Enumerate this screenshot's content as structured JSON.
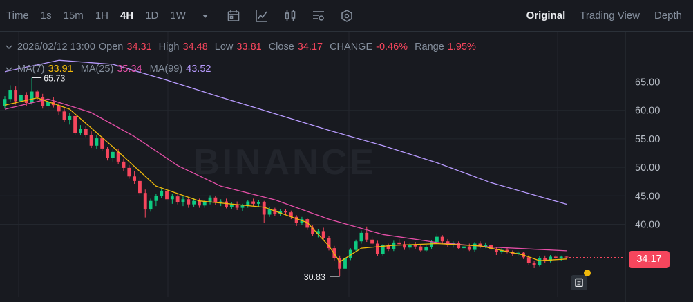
{
  "toolbar": {
    "timeframes": [
      "Time",
      "1s",
      "15m",
      "1H",
      "4H",
      "1D",
      "1W"
    ],
    "active_timeframe": "4H",
    "views": [
      "Original",
      "Trading View",
      "Depth"
    ],
    "active_view": "Original"
  },
  "ohlc": {
    "datetime": "2026/02/12 13:00",
    "open_label": "Open",
    "open": "34.31",
    "high_label": "High",
    "high": "34.48",
    "low_label": "Low",
    "low": "33.81",
    "close_label": "Close",
    "close": "34.17",
    "change_label": "CHANGE",
    "change": "-0.46%",
    "range_label": "Range",
    "range": "1.95%"
  },
  "ma": {
    "ma7_label": "MA(7)",
    "ma7": "33.91",
    "ma25_label": "MA(25)",
    "ma25": "35.34",
    "ma99_label": "MA(99)",
    "ma99": "43.52"
  },
  "watermark": "BINANCE",
  "current_price": "34.17",
  "colors": {
    "up": "#0ecb81",
    "down": "#f6465d",
    "ma7": "#f0b90b",
    "ma25": "#e64fa8",
    "ma99": "#b89bff",
    "background": "#181a20",
    "grid": "#23272e"
  },
  "chart_data": {
    "type": "candlestick",
    "y_ticks": [
      "65.00",
      "60.00",
      "55.00",
      "50.00",
      "45.00",
      "40.00"
    ],
    "ylim": [
      28.0,
      70.0
    ],
    "grid": true,
    "high_marker": "65.73",
    "low_marker": "30.83",
    "candles": [
      [
        60.8,
        62.5,
        60.3,
        62.0
      ],
      [
        62.0,
        64.4,
        61.5,
        63.6
      ],
      [
        63.6,
        64.2,
        61.0,
        61.6
      ],
      [
        61.6,
        63.0,
        60.9,
        62.7
      ],
      [
        62.7,
        63.2,
        60.7,
        61.3
      ],
      [
        61.3,
        65.73,
        61.0,
        63.3
      ],
      [
        63.3,
        63.6,
        61.9,
        62.3
      ],
      [
        62.3,
        62.9,
        60.3,
        60.8
      ],
      [
        60.8,
        62.0,
        60.0,
        61.5
      ],
      [
        61.5,
        62.3,
        60.5,
        60.9
      ],
      [
        60.9,
        61.4,
        59.2,
        59.8
      ],
      [
        59.8,
        60.3,
        57.9,
        58.3
      ],
      [
        58.3,
        59.6,
        57.5,
        59.0
      ],
      [
        59.0,
        59.3,
        55.6,
        56.0
      ],
      [
        56.0,
        57.4,
        55.6,
        56.8
      ],
      [
        56.8,
        57.3,
        55.3,
        55.7
      ],
      [
        55.7,
        56.3,
        53.4,
        53.8
      ],
      [
        53.8,
        55.6,
        53.2,
        55.1
      ],
      [
        55.1,
        55.4,
        52.9,
        53.3
      ],
      [
        53.3,
        53.6,
        51.2,
        51.7
      ],
      [
        51.7,
        53.2,
        51.0,
        52.7
      ],
      [
        52.7,
        53.3,
        50.6,
        51.0
      ],
      [
        51.0,
        51.5,
        49.3,
        49.9
      ],
      [
        49.9,
        50.4,
        48.0,
        48.4
      ],
      [
        48.4,
        49.3,
        47.1,
        47.6
      ],
      [
        47.6,
        48.3,
        45.1,
        45.5
      ],
      [
        45.5,
        46.1,
        41.2,
        42.6
      ],
      [
        42.6,
        44.5,
        42.2,
        44.1
      ],
      [
        44.1,
        45.4,
        43.2,
        45.0
      ],
      [
        45.0,
        46.3,
        44.6,
        45.9
      ],
      [
        45.9,
        46.3,
        44.0,
        44.4
      ],
      [
        44.4,
        45.3,
        43.6,
        44.9
      ],
      [
        44.9,
        45.3,
        43.5,
        43.9
      ],
      [
        43.9,
        44.9,
        43.2,
        44.4
      ],
      [
        44.4,
        44.8,
        42.9,
        43.5
      ],
      [
        43.5,
        44.6,
        43.1,
        44.1
      ],
      [
        44.1,
        44.5,
        42.9,
        43.3
      ],
      [
        43.3,
        44.2,
        42.9,
        43.9
      ],
      [
        43.9,
        45.1,
        43.5,
        44.7
      ],
      [
        44.7,
        45.0,
        43.4,
        43.8
      ],
      [
        43.8,
        44.4,
        43.2,
        44.0
      ],
      [
        44.0,
        44.5,
        42.8,
        43.1
      ],
      [
        43.1,
        43.9,
        42.7,
        43.5
      ],
      [
        43.5,
        44.0,
        42.5,
        42.9
      ],
      [
        42.9,
        43.6,
        42.3,
        43.3
      ],
      [
        43.3,
        44.3,
        42.9,
        44.0
      ],
      [
        44.0,
        44.5,
        43.2,
        43.6
      ],
      [
        43.6,
        44.2,
        43.1,
        43.9
      ],
      [
        43.9,
        44.1,
        40.2,
        41.7
      ],
      [
        41.7,
        43.1,
        41.3,
        42.6
      ],
      [
        42.6,
        42.9,
        41.4,
        41.8
      ],
      [
        41.8,
        42.7,
        41.5,
        42.3
      ],
      [
        42.3,
        42.7,
        41.7,
        42.1
      ],
      [
        42.1,
        42.4,
        40.9,
        41.3
      ],
      [
        41.3,
        41.6,
        39.7,
        40.3
      ],
      [
        40.3,
        41.3,
        39.9,
        40.9
      ],
      [
        40.9,
        41.1,
        39.0,
        39.4
      ],
      [
        39.4,
        39.8,
        37.9,
        38.3
      ],
      [
        38.3,
        39.1,
        37.7,
        38.8
      ],
      [
        38.8,
        39.4,
        37.2,
        37.6
      ],
      [
        37.6,
        38.0,
        35.4,
        35.8
      ],
      [
        35.8,
        36.2,
        33.6,
        34.0
      ],
      [
        34.0,
        34.5,
        30.83,
        32.2
      ],
      [
        32.2,
        34.4,
        31.8,
        34.0
      ],
      [
        34.0,
        35.8,
        33.7,
        35.5
      ],
      [
        35.5,
        37.3,
        35.2,
        37.0
      ],
      [
        37.0,
        38.9,
        36.6,
        38.5
      ],
      [
        38.5,
        39.6,
        36.9,
        37.3
      ],
      [
        37.3,
        37.8,
        36.3,
        36.6
      ],
      [
        36.6,
        37.1,
        34.4,
        34.8
      ],
      [
        34.8,
        36.5,
        34.5,
        36.3
      ],
      [
        36.3,
        36.6,
        35.3,
        35.6
      ],
      [
        35.6,
        37.1,
        35.3,
        36.8
      ],
      [
        36.8,
        37.4,
        36.2,
        36.5
      ],
      [
        36.5,
        37.0,
        35.5,
        35.9
      ],
      [
        35.9,
        36.7,
        35.5,
        36.3
      ],
      [
        36.3,
        36.9,
        35.7,
        36.1
      ],
      [
        36.1,
        36.5,
        35.1,
        35.4
      ],
      [
        35.4,
        36.3,
        35.1,
        36.0
      ],
      [
        36.0,
        37.2,
        35.7,
        36.9
      ],
      [
        36.9,
        38.4,
        36.6,
        37.8
      ],
      [
        37.8,
        38.1,
        36.6,
        37.0
      ],
      [
        37.0,
        37.4,
        36.0,
        36.4
      ],
      [
        36.4,
        37.0,
        35.9,
        36.7
      ],
      [
        36.7,
        37.0,
        35.6,
        35.8
      ],
      [
        35.8,
        36.4,
        35.1,
        36.1
      ],
      [
        36.1,
        36.6,
        35.3,
        35.5
      ],
      [
        35.5,
        36.9,
        35.2,
        36.6
      ],
      [
        36.6,
        37.0,
        35.8,
        36.1
      ],
      [
        36.1,
        36.8,
        35.8,
        36.3
      ],
      [
        36.3,
        36.5,
        35.4,
        35.6
      ],
      [
        35.6,
        36.0,
        34.6,
        35.1
      ],
      [
        35.1,
        35.8,
        34.8,
        35.5
      ],
      [
        35.5,
        35.9,
        34.9,
        35.2
      ],
      [
        35.2,
        35.4,
        34.4,
        34.8
      ],
      [
        34.8,
        35.3,
        34.4,
        35.0
      ],
      [
        35.0,
        35.2,
        33.9,
        34.2
      ],
      [
        34.2,
        34.6,
        32.9,
        33.2
      ],
      [
        33.2,
        33.6,
        32.3,
        32.8
      ],
      [
        32.8,
        34.4,
        32.6,
        34.1
      ],
      [
        34.1,
        34.5,
        33.2,
        33.5
      ],
      [
        33.5,
        34.6,
        33.3,
        34.3
      ],
      [
        34.3,
        34.6,
        33.7,
        34.0
      ],
      [
        34.0,
        34.5,
        33.6,
        34.3
      ],
      [
        34.3,
        34.48,
        33.81,
        34.17
      ]
    ],
    "ma7": [
      [
        0,
        60.9
      ],
      [
        6,
        62.2
      ],
      [
        12,
        60.2
      ],
      [
        20,
        53.6
      ],
      [
        28,
        46.7
      ],
      [
        36,
        44.1
      ],
      [
        48,
        43.0
      ],
      [
        56,
        40.3
      ],
      [
        60,
        36.2
      ],
      [
        62,
        33.4
      ],
      [
        66,
        35.8
      ],
      [
        72,
        36.3
      ],
      [
        80,
        36.6
      ],
      [
        88,
        36.2
      ],
      [
        96,
        34.6
      ],
      [
        99,
        33.6
      ],
      [
        104,
        33.9
      ]
    ],
    "ma25": [
      [
        0,
        60.2
      ],
      [
        8,
        62.0
      ],
      [
        16,
        59.6
      ],
      [
        24,
        55.4
      ],
      [
        32,
        50.3
      ],
      [
        40,
        46.7
      ],
      [
        50,
        44.3
      ],
      [
        60,
        40.9
      ],
      [
        70,
        38.2
      ],
      [
        80,
        36.8
      ],
      [
        90,
        36.0
      ],
      [
        104,
        35.34
      ]
    ],
    "ma99": [
      [
        0,
        66.8
      ],
      [
        10,
        68.8
      ],
      [
        20,
        68.1
      ],
      [
        30,
        65.3
      ],
      [
        40,
        62.3
      ],
      [
        50,
        59.4
      ],
      [
        60,
        56.5
      ],
      [
        70,
        53.8
      ],
      [
        80,
        50.8
      ],
      [
        90,
        47.3
      ],
      [
        104,
        43.52
      ]
    ]
  }
}
